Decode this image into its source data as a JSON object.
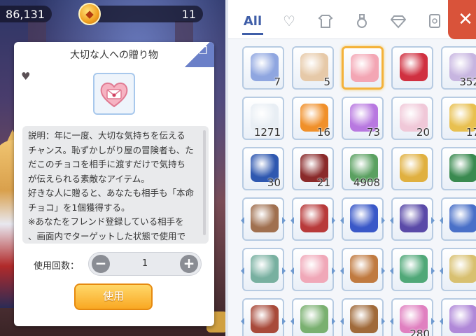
{
  "topbar": {
    "gold_amount": "86,131",
    "jewel_amount": "11"
  },
  "detail": {
    "title": "大切な人への贈り物",
    "description": "説明：年に一度、大切な気持ちを伝える\nチャンス。恥ずかしがり屋の冒険者も、た\nだこのチョコを相手に渡すだけで気持ち\nが伝えられる素敵なアイテム。\n好きな人に贈ると、あなたも相手も「本命\nチョコ」を1個獲得する。\n※あなたをフレンド登録している相手を\n、画面内でターゲットした状態で使用で",
    "use_count_label": "使用回数：",
    "quantity": "1",
    "use_button": "使用",
    "minus_symbol": "−",
    "plus_symbol": "+"
  },
  "inventory": {
    "tabs": [
      {
        "label": "All",
        "icon": "all-tab",
        "active": true
      },
      {
        "label": "",
        "icon": "heart-icon",
        "active": false
      },
      {
        "label": "",
        "icon": "armor-icon",
        "active": false
      },
      {
        "label": "",
        "icon": "potion-icon",
        "active": false
      },
      {
        "label": "",
        "icon": "diamond-icon",
        "active": false
      },
      {
        "label": "",
        "icon": "card-icon",
        "active": false
      }
    ],
    "close_symbol": "✕",
    "rows": [
      [
        {
          "icon": "scroll-icon",
          "qty": "7",
          "color": "#8fa6e0"
        },
        {
          "icon": "gift-bag-icon",
          "qty": "5",
          "color": "#e6c9a8"
        },
        {
          "icon": "heart-letter-icon",
          "qty": "",
          "color": "#f3a6b4",
          "selected": true
        },
        {
          "icon": "rose-icon",
          "qty": "",
          "color": "#d03040"
        },
        {
          "icon": "feather-wing-icon",
          "qty": "352",
          "color": "#c7b5e0"
        }
      ],
      [
        {
          "icon": "white-feather-icon",
          "qty": "1271",
          "color": "#e8eef4"
        },
        {
          "icon": "orange-orb-icon",
          "qty": "16",
          "color": "#f0902a"
        },
        {
          "icon": "butterfly-wings-icon",
          "qty": "73",
          "color": "#b878e0"
        },
        {
          "icon": "candy-bag-icon",
          "qty": "20",
          "color": "#f0c8d8"
        },
        {
          "icon": "star-card-icon",
          "qty": "17",
          "color": "#e8c050"
        }
      ],
      [
        {
          "icon": "cross-shield-icon",
          "qty": "30",
          "color": "#2f58b0"
        },
        {
          "icon": "sword-emblem-icon",
          "qty": "21",
          "color": "#8a2a2a"
        },
        {
          "icon": "leaf-icon",
          "qty": "4908",
          "color": "#5aa060"
        },
        {
          "icon": "gold-crest-icon",
          "qty": "",
          "color": "#e0b040"
        },
        {
          "icon": "green-book-icon",
          "qty": "",
          "color": "#3a8a50"
        }
      ],
      [
        {
          "icon": "pouch-icon",
          "qty": "",
          "color": "#a07050"
        },
        {
          "icon": "red-chest-icon",
          "qty": "",
          "color": "#b83a3a"
        },
        {
          "icon": "blue-box-icon",
          "qty": "",
          "color": "#3a58c8"
        },
        {
          "icon": "purple-drum-icon",
          "qty": "",
          "color": "#5a4aa8"
        },
        {
          "icon": "blue-chest-icon",
          "qty": "",
          "color": "#4a70c8"
        }
      ],
      [
        {
          "icon": "colorful-box-icon",
          "qty": "",
          "color": "#78b0a0"
        },
        {
          "icon": "pink-box-icon",
          "qty": "",
          "color": "#f0a8b8"
        },
        {
          "icon": "brown-book-icon",
          "qty": "",
          "color": "#c07a40"
        },
        {
          "icon": "card-box-icon",
          "qty": "",
          "color": "#50a878"
        },
        {
          "icon": "gold-box-icon",
          "qty": "",
          "color": "#d8c070"
        }
      ],
      [
        {
          "icon": "red-book-icon",
          "qty": "",
          "color": "#a84a3a"
        },
        {
          "icon": "green-crate-icon",
          "qty": "",
          "color": "#7ab070"
        },
        {
          "icon": "backpack-icon",
          "qty": "",
          "color": "#a06a3a"
        },
        {
          "icon": "pink-ring-icon",
          "qty": "280",
          "color": "#e080c0"
        },
        {
          "icon": "crystal-icon",
          "qty": "",
          "color": "#b088d8"
        }
      ]
    ]
  }
}
